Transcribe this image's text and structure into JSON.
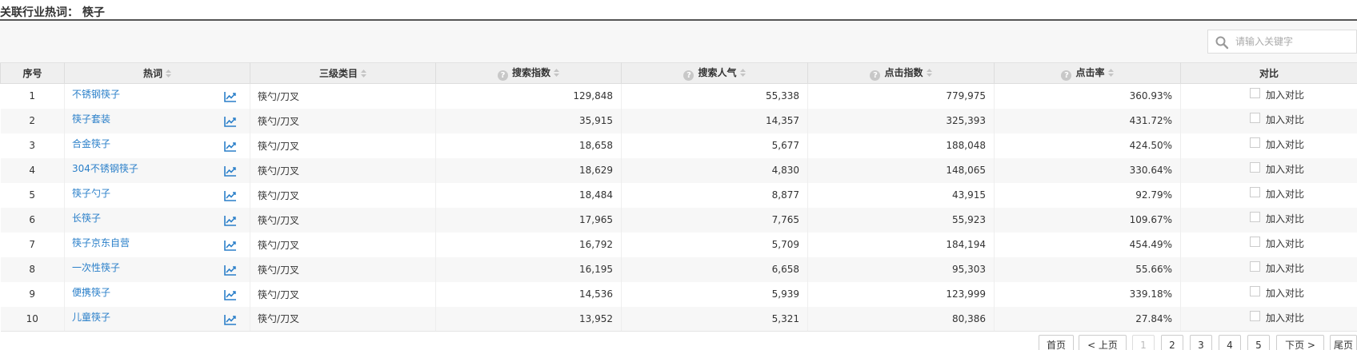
{
  "header": {
    "title": "关联行业热词： 筷子"
  },
  "search": {
    "placeholder": "请输入关键字"
  },
  "columns": {
    "index": "序号",
    "keyword": "热词",
    "category": "三级类目",
    "search_index": "搜索指数",
    "search_popularity": "搜索人气",
    "click_index": "点击指数",
    "click_rate": "点击率",
    "compare": "对比"
  },
  "rows": [
    {
      "index": "1",
      "keyword": "不锈钢筷子",
      "category": "筷勺/刀叉",
      "search_index": "129,848",
      "search_popularity": "55,338",
      "click_index": "779,975",
      "click_rate": "360.93%",
      "compare": "加入对比"
    },
    {
      "index": "2",
      "keyword": "筷子套装",
      "category": "筷勺/刀叉",
      "search_index": "35,915",
      "search_popularity": "14,357",
      "click_index": "325,393",
      "click_rate": "431.72%",
      "compare": "加入对比"
    },
    {
      "index": "3",
      "keyword": "合金筷子",
      "category": "筷勺/刀叉",
      "search_index": "18,658",
      "search_popularity": "5,677",
      "click_index": "188,048",
      "click_rate": "424.50%",
      "compare": "加入对比"
    },
    {
      "index": "4",
      "keyword": "304不锈钢筷子",
      "category": "筷勺/刀叉",
      "search_index": "18,629",
      "search_popularity": "4,830",
      "click_index": "148,065",
      "click_rate": "330.64%",
      "compare": "加入对比"
    },
    {
      "index": "5",
      "keyword": "筷子勺子",
      "category": "筷勺/刀叉",
      "search_index": "18,484",
      "search_popularity": "8,877",
      "click_index": "43,915",
      "click_rate": "92.79%",
      "compare": "加入对比"
    },
    {
      "index": "6",
      "keyword": "长筷子",
      "category": "筷勺/刀叉",
      "search_index": "17,965",
      "search_popularity": "7,765",
      "click_index": "55,923",
      "click_rate": "109.67%",
      "compare": "加入对比"
    },
    {
      "index": "7",
      "keyword": "筷子京东自营",
      "category": "筷勺/刀叉",
      "search_index": "16,792",
      "search_popularity": "5,709",
      "click_index": "184,194",
      "click_rate": "454.49%",
      "compare": "加入对比"
    },
    {
      "index": "8",
      "keyword": "一次性筷子",
      "category": "筷勺/刀叉",
      "search_index": "16,195",
      "search_popularity": "6,658",
      "click_index": "95,303",
      "click_rate": "55.66%",
      "compare": "加入对比"
    },
    {
      "index": "9",
      "keyword": "便携筷子",
      "category": "筷勺/刀叉",
      "search_index": "14,536",
      "search_popularity": "5,939",
      "click_index": "123,999",
      "click_rate": "339.18%",
      "compare": "加入对比"
    },
    {
      "index": "10",
      "keyword": "儿童筷子",
      "category": "筷勺/刀叉",
      "search_index": "13,952",
      "search_popularity": "5,321",
      "click_index": "80,386",
      "click_rate": "27.84%",
      "compare": "加入对比"
    }
  ],
  "pager": {
    "first": "首页",
    "prev": "< 上页",
    "pages": [
      "1",
      "2",
      "3",
      "4",
      "5"
    ],
    "current_page": "1",
    "next": "下页 >",
    "last": "尾页"
  },
  "colors": {
    "link": "#2a7fc9",
    "header_bg": "#efefef",
    "stripe": "#f7f7f7"
  },
  "icons": [
    "search-icon",
    "sort-icon",
    "help-icon",
    "trend-chart-icon",
    "checkbox"
  ]
}
